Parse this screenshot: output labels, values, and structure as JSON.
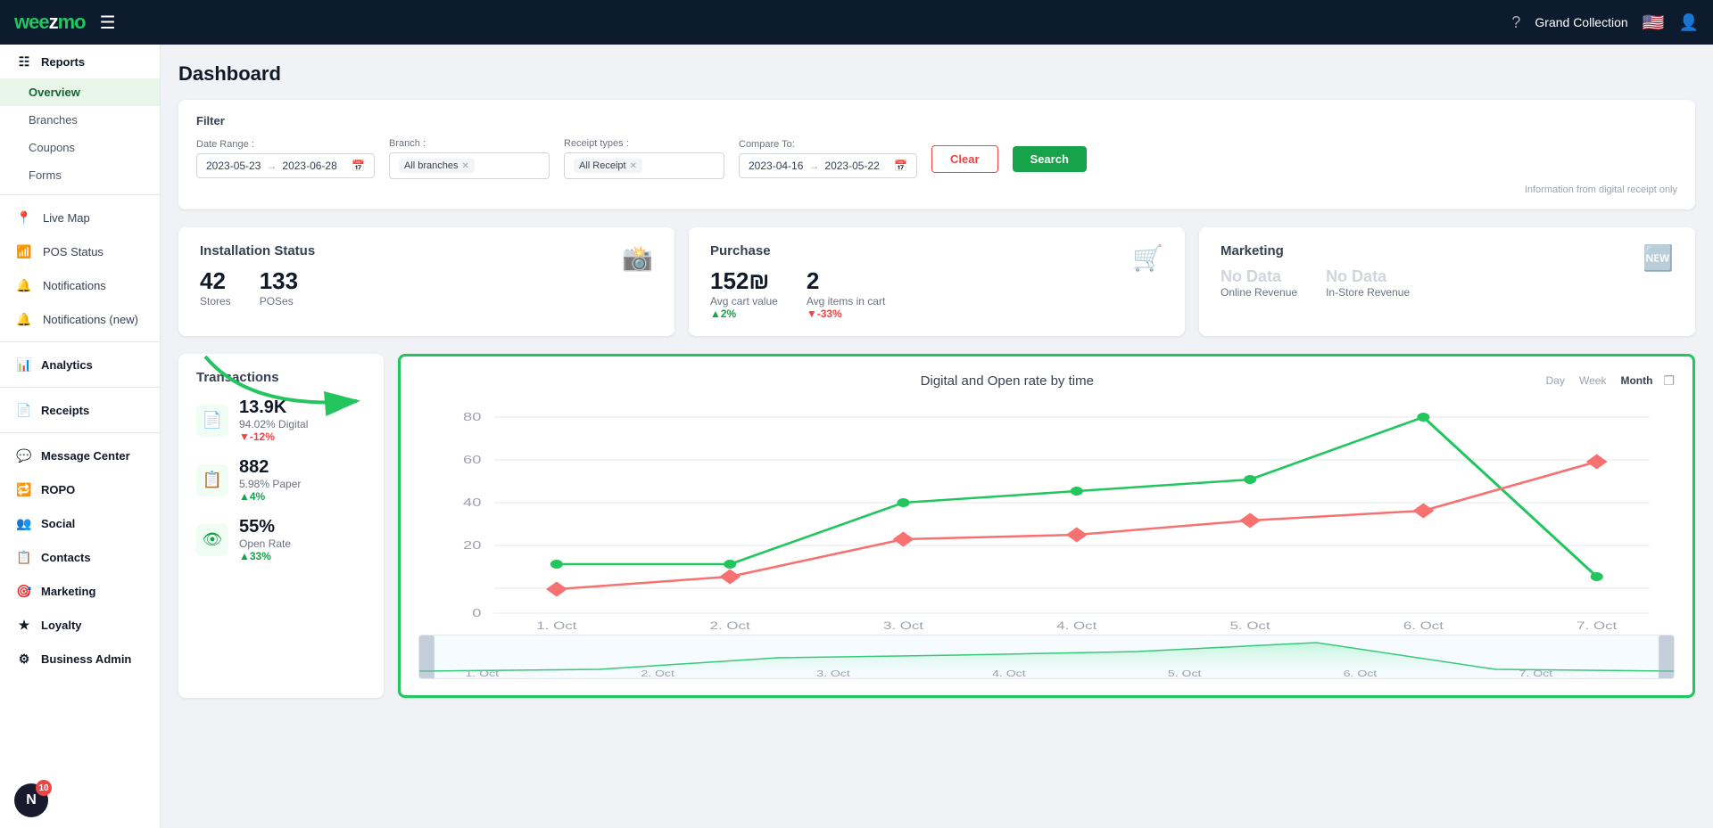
{
  "app": {
    "logo": "weezmo",
    "org_name": "Grand Collection"
  },
  "topnav": {
    "help_icon": "?",
    "flag": "🇺🇸"
  },
  "sidebar": {
    "reports_label": "Reports",
    "overview_label": "Overview",
    "branches_label": "Branches",
    "coupons_label": "Coupons",
    "forms_label": "Forms",
    "livemap_label": "Live Map",
    "pos_label": "POS Status",
    "notifications_label": "Notifications",
    "notifications_new_label": "Notifications (new)",
    "analytics_label": "Analytics",
    "receipts_label": "Receipts",
    "message_center_label": "Message Center",
    "ropo_label": "ROPO",
    "social_label": "Social",
    "contacts_label": "Contacts",
    "marketing_label": "Marketing",
    "loyalty_label": "Loyalty",
    "business_admin_label": "Business Admin",
    "avatar_letter": "N",
    "badge_count": "10"
  },
  "page": {
    "title": "Dashboard"
  },
  "filter": {
    "section_label": "Filter",
    "date_range_label": "Date Range :",
    "date_start": "2023-05-23",
    "date_end": "2023-06-28",
    "branch_label": "Branch :",
    "branch_value": "All branches",
    "receipt_label": "Receipt types :",
    "receipt_value": "All Receipt",
    "compare_label": "Compare To:",
    "compare_start": "2023-04-16",
    "compare_end": "2023-05-22",
    "clear_btn": "Clear",
    "search_btn": "Search",
    "note": "Information from digital receipt only"
  },
  "installation": {
    "title": "Installation Status",
    "stores_value": "42",
    "stores_label": "Stores",
    "poses_value": "133",
    "poses_label": "POSes"
  },
  "purchase": {
    "title": "Purchase",
    "avg_cart_value": "152₪",
    "avg_cart_label": "Avg cart value",
    "avg_cart_trend": "▲2%",
    "avg_items": "2",
    "avg_items_label": "Avg items in cart",
    "avg_items_trend": "▼-33%"
  },
  "marketing": {
    "title": "Marketing",
    "online_label": "Online Revenue",
    "online_value": "No Data",
    "instore_label": "In-Store Revenue",
    "instore_value": "No Data"
  },
  "transactions": {
    "title": "Transactions",
    "digital_value": "13.9K",
    "digital_pct": "94.02% Digital",
    "digital_trend": "▼-12%",
    "paper_value": "882",
    "paper_pct": "5.98% Paper",
    "paper_trend": "▲4%",
    "open_value": "55%",
    "open_label": "Open Rate",
    "open_trend": "▲33%"
  },
  "chart": {
    "title": "Digital and Open rate by time",
    "period_day": "Day",
    "period_week": "Week",
    "period_month": "Month",
    "x_labels": [
      "1. Oct",
      "2. Oct",
      "3. Oct",
      "4. Oct",
      "5. Oct",
      "6. Oct",
      "7. Oct"
    ],
    "y_labels": [
      "80",
      "60",
      "40",
      "20",
      "0"
    ],
    "green_line": [
      20,
      20,
      45,
      50,
      55,
      80,
      15
    ],
    "red_line": [
      10,
      15,
      30,
      32,
      38,
      42,
      62
    ]
  }
}
